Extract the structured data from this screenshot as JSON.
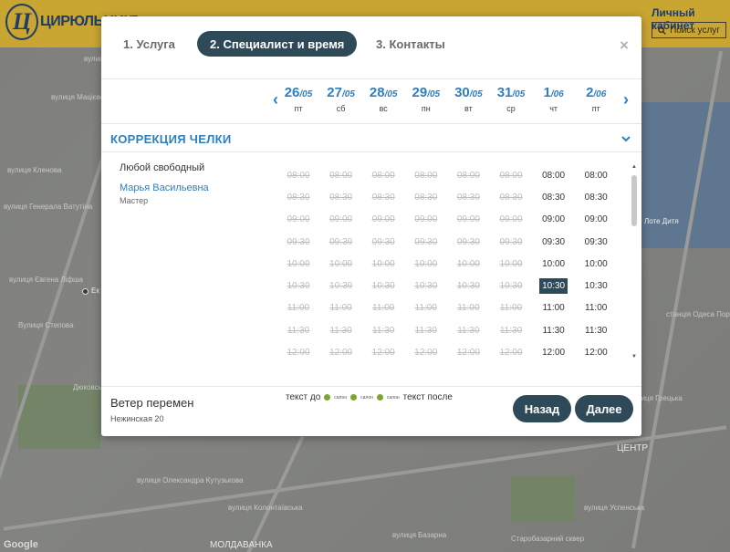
{
  "header": {
    "logo_letter": "Ц",
    "logo_text": "ЦИРЮЛЬНИКЪ",
    "cabinet_label": "Личный кабинет",
    "search_label": "Поиск услуг"
  },
  "map": {
    "labels": [
      "вулиця Мацієвська",
      "вулиця Тваринна",
      "вулиця Кленова",
      "вулиця Генерала Ватутіна",
      "Вулиця Степова",
      "вулиця Євгена Ліфша",
      "Дюковський сад",
      "вулиця Олександра Кутузькова",
      "вулиця Колонтаївська",
      "ЦЕНТР",
      "МОЛДАВАНКА",
      "Лоте Дитя",
      "станція Одеса Порт",
      "вулиця Грецька",
      "вулиця Базарна",
      "Старобазарний сквер",
      "вулиця Успенська",
      "Ек"
    ],
    "attribution": "Google"
  },
  "modal": {
    "steps": [
      {
        "label": "1. Услуга",
        "active": false
      },
      {
        "label": "2. Специалист и время",
        "active": true
      },
      {
        "label": "3. Контакты",
        "active": false
      }
    ],
    "close_icon": "×",
    "dates": [
      {
        "day": "26",
        "month": "/05",
        "weekday": "пт"
      },
      {
        "day": "27",
        "month": "/05",
        "weekday": "сб"
      },
      {
        "day": "28",
        "month": "/05",
        "weekday": "вс"
      },
      {
        "day": "29",
        "month": "/05",
        "weekday": "пн"
      },
      {
        "day": "30",
        "month": "/05",
        "weekday": "вт"
      },
      {
        "day": "31",
        "month": "/05",
        "weekday": "ср"
      },
      {
        "day": "1",
        "month": "/06",
        "weekday": "чт"
      },
      {
        "day": "2",
        "month": "/06",
        "weekday": "пт"
      }
    ],
    "service_title": "КОРРЕКЦИЯ ЧЕЛКИ",
    "specialists": {
      "any": "Любой свободный",
      "name": "Марья Васильевна",
      "role": "Мастер"
    },
    "times": [
      "08:00",
      "08:30",
      "09:00",
      "09:30",
      "10:00",
      "10:30",
      "11:00",
      "11:30",
      "12:00"
    ],
    "busy_columns": 6,
    "selected_slot": {
      "date_index": 6,
      "time": "10:30"
    },
    "footer": {
      "salon_name": "Ветер перемен",
      "address": "Нежинская 20",
      "legend_before": "текст до",
      "legend_after": "текст после",
      "legend_dots": [
        "салон",
        "салон",
        "салон"
      ],
      "back_label": "Назад",
      "next_label": "Далее"
    }
  },
  "colors": {
    "accent_blue": "#2f7fc0",
    "dark_button": "#2e4a59",
    "brand_yellow": "#c9a531"
  }
}
